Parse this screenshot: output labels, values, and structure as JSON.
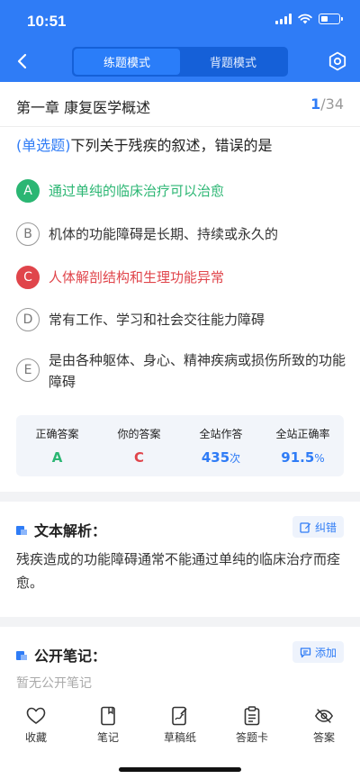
{
  "status_bar": {
    "time": "10:51"
  },
  "header": {
    "modes": [
      {
        "label": "练题模式",
        "active": true
      },
      {
        "label": "背题模式",
        "active": false
      }
    ]
  },
  "chapter": {
    "title": "第一章 康复医学概述",
    "current": "1",
    "total": "/34"
  },
  "question": {
    "type_label": "(单选题)",
    "text": "下列关于残疾的叙述，错误的是",
    "options": [
      {
        "letter": "A",
        "text": "通过单纯的临床治疗可以治愈",
        "state": "correct"
      },
      {
        "letter": "B",
        "text": "机体的功能障碍是长期、持续或永久的",
        "state": "normal"
      },
      {
        "letter": "C",
        "text": "人体解剖结构和生理功能异常",
        "state": "wrong"
      },
      {
        "letter": "D",
        "text": "常有工作、学习和社会交往能力障碍",
        "state": "normal"
      },
      {
        "letter": "E",
        "text": "是由各种躯体、身心、精神疾病或损伤所致的功能障碍",
        "state": "normal"
      }
    ]
  },
  "stats": {
    "correct_answer": {
      "label": "正确答案",
      "value": "A"
    },
    "your_answer": {
      "label": "你的答案",
      "value": "C"
    },
    "site_attempts": {
      "label": "全站作答",
      "value": "435",
      "unit": "次"
    },
    "site_accuracy": {
      "label": "全站正确率",
      "value": "91.5",
      "unit": "%"
    }
  },
  "analysis": {
    "title": "文本解析：",
    "button_label": "纠错",
    "text": "残疾造成的功能障碍通常不能通过单纯的临床治疗而痊愈。"
  },
  "notes": {
    "title": "公开笔记：",
    "button_label": "添加",
    "empty_text": "暂无公开笔记"
  },
  "tabbar": [
    {
      "label": "收藏",
      "icon": "heart-icon"
    },
    {
      "label": "笔记",
      "icon": "notebook-icon"
    },
    {
      "label": "草稿纸",
      "icon": "draft-icon"
    },
    {
      "label": "答题卡",
      "icon": "clipboard-icon"
    },
    {
      "label": "答案",
      "icon": "eye-off-icon"
    }
  ],
  "colors": {
    "primary": "#2f7cf6",
    "correct": "#2bb673",
    "wrong": "#e0454b"
  }
}
